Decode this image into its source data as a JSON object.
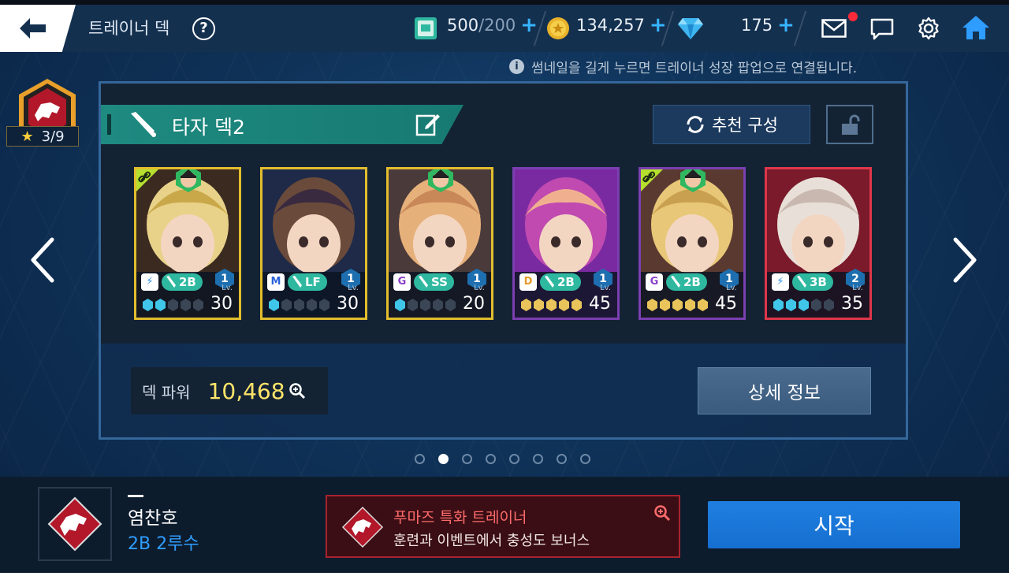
{
  "header": {
    "title": "트레이너 덱",
    "help": "?",
    "tickets": {
      "value": "500",
      "max": "/200",
      "plus": "+"
    },
    "coins": {
      "value": "134,257",
      "plus": "+"
    },
    "gems": {
      "value": "175",
      "plus": "+"
    }
  },
  "hint": "썸네일을 길게 누르면 트레이너 성장 팝업으로 연결됩니다.",
  "hint_icon": "i",
  "trainer_badge": {
    "stars": "3/9",
    "star_icon": "★"
  },
  "deck": {
    "name": "타자 덱2",
    "recommend_label": "추천 구성",
    "power_label": "덱 파워",
    "power_value": "10,468",
    "detail_label": "상세 정보"
  },
  "cards": [
    {
      "type": "⚡",
      "position": "2B",
      "grade": "1",
      "level": "30",
      "lv_label": "Lv.",
      "gems": 2,
      "gem_total": 5,
      "gem_color": "#3fc6e8",
      "frame": "#e2bd2d",
      "link": true,
      "coach": true
    },
    {
      "type": "M",
      "position": "LF",
      "grade": "1",
      "level": "30",
      "lv_label": "Lv.",
      "gems": 1,
      "gem_total": 5,
      "gem_color": "#3fc6e8",
      "frame": "#e2bd2d",
      "link": false,
      "coach": false
    },
    {
      "type": "G",
      "position": "SS",
      "grade": "1",
      "level": "20",
      "lv_label": "Lv.",
      "gems": 1,
      "gem_total": 5,
      "gem_color": "#3fc6e8",
      "frame": "#e2bd2d",
      "link": false,
      "coach": true
    },
    {
      "type": "D",
      "position": "2B",
      "grade": "1",
      "level": "45",
      "lv_label": "Lv.",
      "gems": 5,
      "gem_total": 5,
      "gem_color": "#e8c45a",
      "frame": "#7a3fb0",
      "link": false,
      "coach": false
    },
    {
      "type": "G",
      "position": "2B",
      "grade": "1",
      "level": "45",
      "lv_label": "Lv.",
      "gems": 5,
      "gem_total": 5,
      "gem_color": "#e8c45a",
      "frame": "#7a3fb0",
      "link": true,
      "coach": true
    },
    {
      "type": "⚡",
      "position": "3B",
      "grade": "2",
      "level": "35",
      "lv_label": "Lv.",
      "gems": 3,
      "gem_total": 5,
      "gem_color": "#3fc6e8",
      "frame": "#e0364a",
      "link": false,
      "coach": false
    }
  ],
  "pager": {
    "count": 8,
    "active": 1
  },
  "player": {
    "name": "염찬호",
    "position": "2B 2루수"
  },
  "specialty": {
    "title": "푸마즈 특화 트레이너",
    "desc": "훈련과 이벤트에서 충성도 보너스"
  },
  "start_label": "시작",
  "icons": {
    "back": "back-arrow-icon",
    "ticket": "ticket-icon",
    "coin": "coin-icon",
    "gem": "diamond-icon",
    "mail": "mail-icon",
    "chat": "chat-icon",
    "settings": "gear-icon",
    "home": "home-icon"
  }
}
